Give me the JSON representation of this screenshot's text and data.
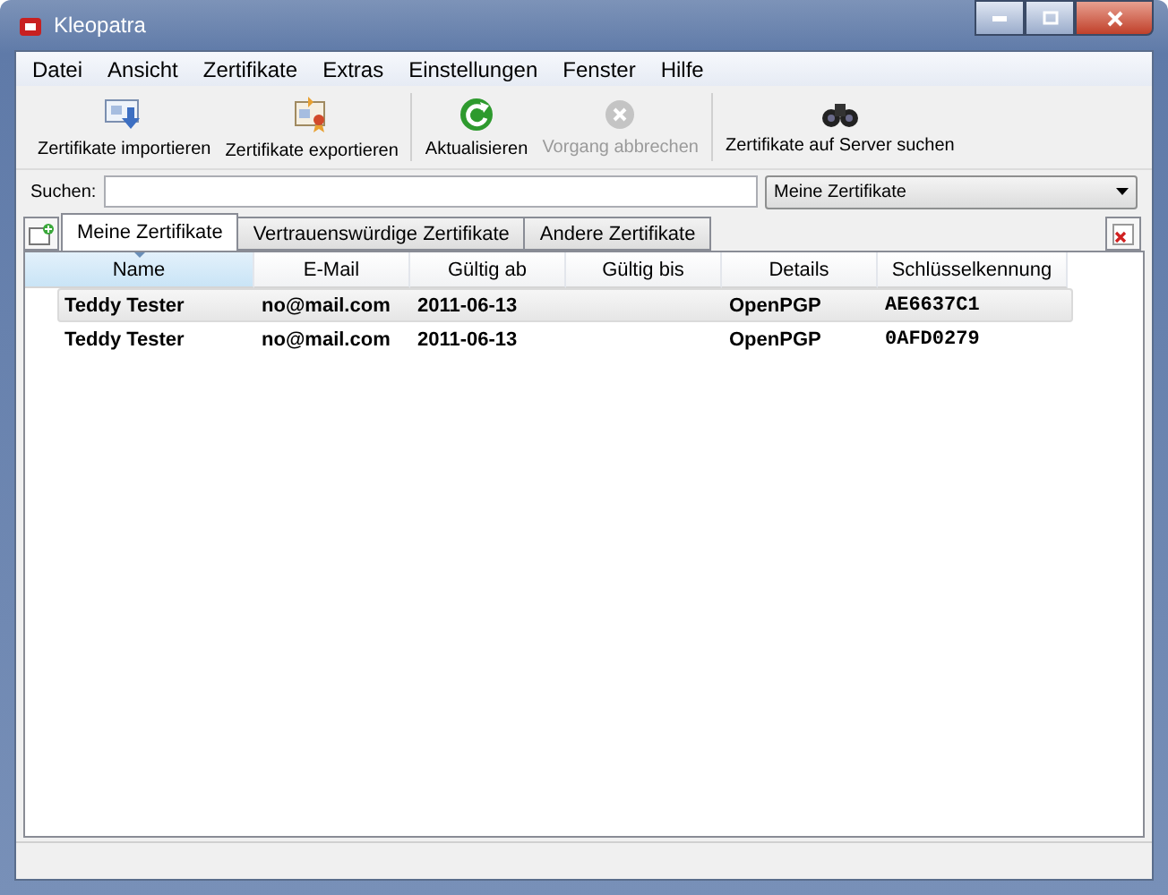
{
  "window": {
    "title": "Kleopatra"
  },
  "menu": [
    "Datei",
    "Ansicht",
    "Zertifikate",
    "Extras",
    "Einstellungen",
    "Fenster",
    "Hilfe"
  ],
  "toolbar": [
    {
      "label": "Zertifikate importieren",
      "kind": "import",
      "disabled": false
    },
    {
      "label": "Zertifikate exportieren",
      "kind": "export",
      "disabled": false
    },
    {
      "label": "Aktualisieren",
      "kind": "refresh",
      "disabled": false
    },
    {
      "label": "Vorgang abbrechen",
      "kind": "cancel",
      "disabled": true
    },
    {
      "label": "Zertifikate auf Server suchen",
      "kind": "lookup",
      "disabled": false
    }
  ],
  "search": {
    "label": "Suchen:",
    "filter": "Meine Zertifikate"
  },
  "tabs": [
    {
      "label": "Meine Zertifikate",
      "selected": true
    },
    {
      "label": "Vertrauenswürdige Zertifikate",
      "selected": false
    },
    {
      "label": "Andere Zertifikate",
      "selected": false
    }
  ],
  "table": {
    "columns": [
      {
        "label": "Name",
        "sorted": true
      },
      {
        "label": "E-Mail",
        "sorted": false
      },
      {
        "label": "Gültig ab",
        "sorted": false
      },
      {
        "label": "Gültig bis",
        "sorted": false
      },
      {
        "label": "Details",
        "sorted": false
      },
      {
        "label": "Schlüsselkennung",
        "sorted": false
      }
    ],
    "rows": [
      {
        "cells": [
          "Teddy Tester",
          "no@mail.com",
          "2011-06-13",
          "",
          "OpenPGP",
          "AE6637C1"
        ],
        "selected": true
      },
      {
        "cells": [
          "Teddy Tester",
          "no@mail.com",
          "2011-06-13",
          "",
          "OpenPGP",
          "0AFD0279"
        ],
        "selected": false
      }
    ]
  }
}
